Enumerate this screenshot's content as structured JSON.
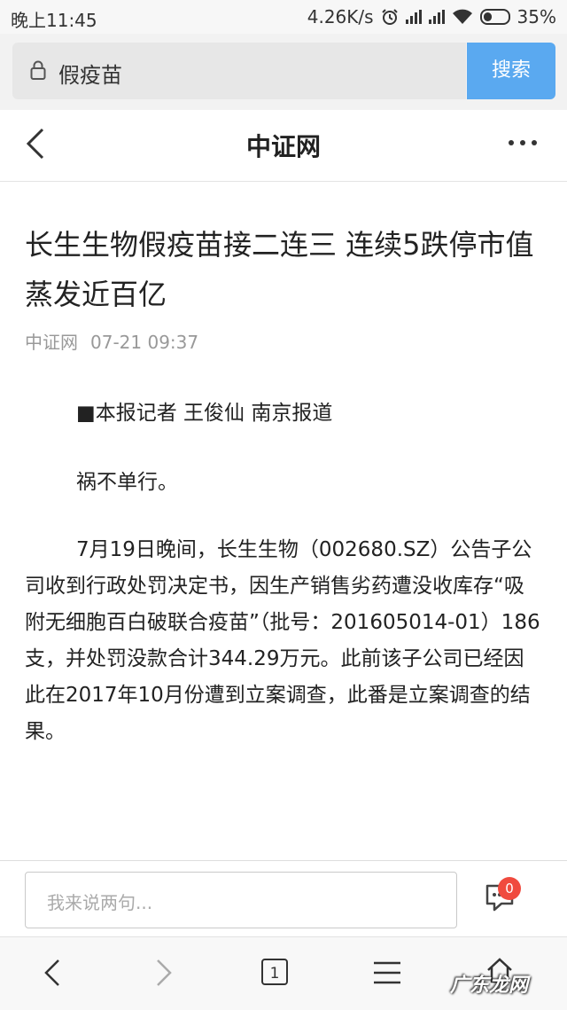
{
  "status": {
    "time": "晚上11:45",
    "speed": "4.26K/s",
    "battery": "35%"
  },
  "search": {
    "query": "假疫苗",
    "button_label": "搜索"
  },
  "nav": {
    "title": "中证网"
  },
  "article": {
    "headline": "长生生物假疫苗接二连三 连续5跌停市值蒸发近百亿",
    "source": "中证网",
    "date": "07-21 09:37",
    "paragraphs": [
      "■本报记者 王俊仙 南京报道",
      "祸不单行。",
      "7月19日晚间，长生生物（002680.SZ）公告子公司收到行政处罚决定书，因生产销售劣药遭没收库存“吸附无细胞百白破联合疫苗”（批号：201605014-01）186支，并处罚没款合计344.29万元。此前该子公司已经因此在2017年10月份遭到立案调查，此番是立案调查的结果。"
    ]
  },
  "comment": {
    "placeholder": "我来说两句...",
    "count": "0"
  },
  "bottom_nav": {
    "tab_count": "1"
  },
  "watermark": "广东龙网",
  "colors": {
    "search_button": "#5aa9f0",
    "badge": "#f04a3e"
  }
}
